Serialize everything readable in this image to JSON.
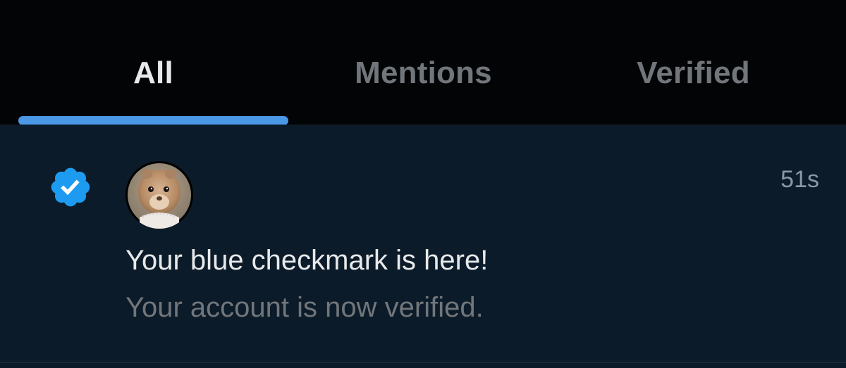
{
  "tabs": [
    {
      "label": "All",
      "active": true
    },
    {
      "label": "Mentions",
      "active": false
    },
    {
      "label": "Verified",
      "active": false
    }
  ],
  "notification": {
    "icon": "verified-badge-icon",
    "avatar_alt": "profile photo",
    "timestamp": "51s",
    "title": "Your blue checkmark is here!",
    "subtitle": "Your account is now verified."
  },
  "colors": {
    "accent": "#1d9bf0",
    "indicator": "#4b98e6",
    "tabbar_bg": "#030406",
    "notification_bg": "#0c1b29",
    "text_primary": "#e7e9ea",
    "text_secondary": "#71767b"
  }
}
